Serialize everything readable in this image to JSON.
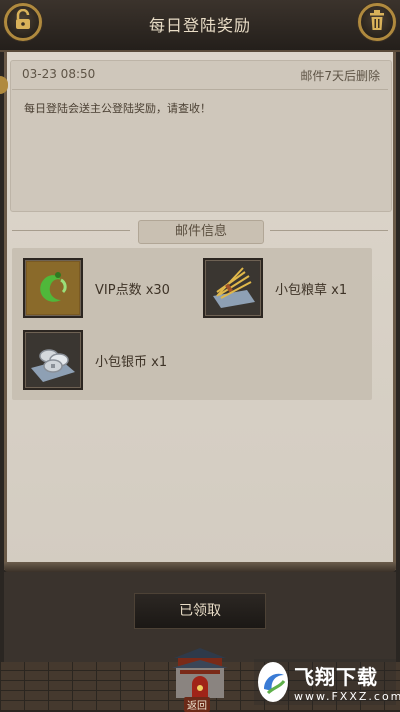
{
  "header": {
    "title": "每日登陆奖励",
    "lock_icon": "lock-icon",
    "trash_icon": "trash-icon"
  },
  "mail": {
    "date": "03-23 08:50",
    "expire_note": "邮件7天后删除",
    "body": "每日登陆会送主公登陆奖励，请查收！"
  },
  "attachments": {
    "section_title": "邮件信息",
    "items": [
      {
        "label": "VIP点数 x30",
        "icon": "vip-points-icon"
      },
      {
        "label": "小包粮草 x1",
        "icon": "grain-bundle-icon"
      },
      {
        "label": "小包银币 x1",
        "icon": "silver-coins-icon"
      }
    ]
  },
  "footer": {
    "claim_button": "已领取",
    "back_label": "返回"
  },
  "watermark": {
    "main": "飞翔下载",
    "sub": "www.FXXZ.com"
  },
  "colors": {
    "parchment": "#d8d0c4",
    "gold_trim": "#b08a3e",
    "dark_bar": "#2a2622"
  }
}
